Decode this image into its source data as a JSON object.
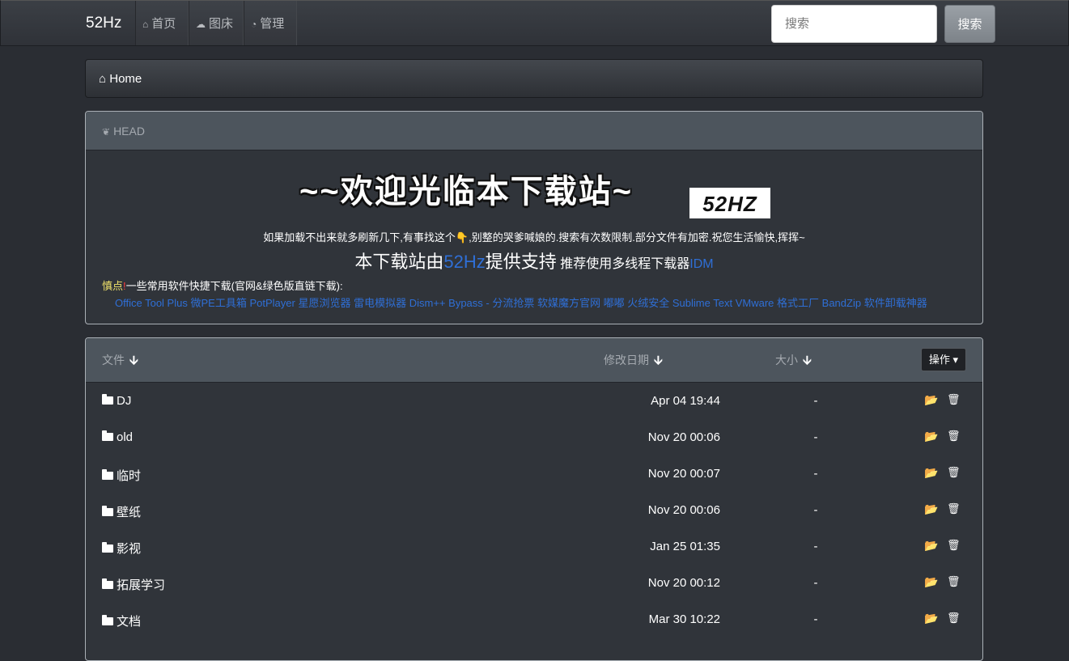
{
  "navbar": {
    "brand": "52Hz",
    "links": [
      {
        "icon": "home-icon",
        "glyph": "⌂",
        "label": "首页"
      },
      {
        "icon": "cloud-upload-icon",
        "glyph": "☁",
        "label": "图床"
      },
      {
        "icon": "dashboard-icon",
        "glyph": "◔",
        "label": "管理"
      }
    ],
    "search_placeholder": "搜索",
    "search_button": "搜索"
  },
  "breadcrumb": {
    "home_icon": "⌂",
    "home": "Home"
  },
  "head": {
    "title_icon": "❦",
    "title": "HEAD",
    "welcome": "~~欢迎光临本下载站~",
    "logo_text": "52HZ",
    "notice_before": "如果加载不出来就多刷新几下,有事找这个",
    "notice_hand": "👇",
    "notice_after": ",别整的哭爹喊娘的.搜索有次数限制.部分文件有加密.祝您生活愉快,挥挥~",
    "support_a": "本下载站由",
    "support_b": "52Hz",
    "support_c": "提供支持",
    "support_d": "推荐使用多线程下载器",
    "support_e": "IDM",
    "quick_warn": "慎点",
    "quick_bang": "!",
    "quick_text": "一些常用软件快捷下载(官网&绿色版直链下载):",
    "quick_links": [
      "Office Tool Plus",
      "微PE工具箱",
      "PotPlayer",
      "星愿浏览器",
      "雷电模拟器",
      "Dism++",
      "Bypass - 分流抢票",
      "软媒魔方官网",
      "嘟嘟",
      "火绒安全",
      "Sublime Text",
      "VMware",
      "格式工厂",
      "BandZip",
      "软件卸载神器"
    ]
  },
  "table": {
    "col_file": "文件",
    "col_date": "修改日期",
    "col_size": "大小",
    "sort_arrow": "🡫",
    "ops_button": "操作 ▾",
    "open_icon": "📂",
    "delete_icon": "🗑",
    "rows": [
      {
        "name": "DJ",
        "date": "Apr 04 19:44",
        "size": "-"
      },
      {
        "name": "old",
        "date": "Nov 20 00:06",
        "size": "-"
      },
      {
        "name": "临时",
        "date": "Nov 20 00:07",
        "size": "-"
      },
      {
        "name": "壁纸",
        "date": "Nov 20 00:06",
        "size": "-"
      },
      {
        "name": "影视",
        "date": "Jan 25 01:35",
        "size": "-"
      },
      {
        "name": "拓展学习",
        "date": "Nov 20 00:12",
        "size": "-"
      },
      {
        "name": "文档",
        "date": "Mar 30 10:22",
        "size": "-"
      }
    ]
  }
}
